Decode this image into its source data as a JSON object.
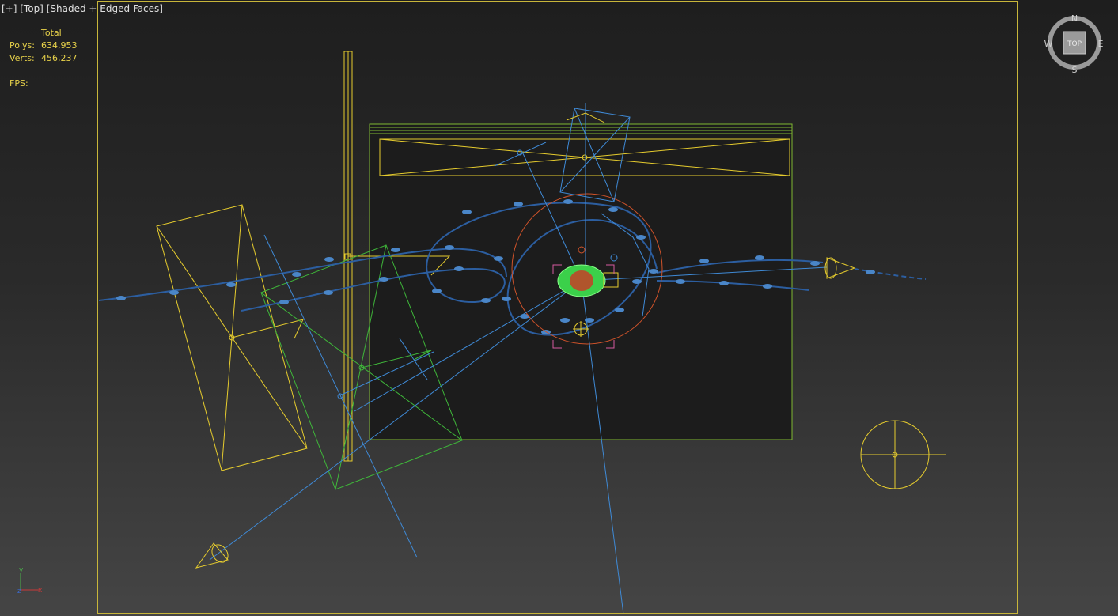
{
  "viewport": {
    "menu_label": "[+]",
    "view_label": "[Top]",
    "shading_label": "[Shaded + Edged Faces]"
  },
  "stats": {
    "header": "Total",
    "polys_label": "Polys:",
    "polys_value": "634,953",
    "verts_label": "Verts:",
    "verts_value": "456,237",
    "fps_label": "FPS:"
  },
  "viewcube": {
    "north": "N",
    "south": "S",
    "east": "E",
    "west": "W",
    "face": "TOP"
  },
  "axis_tripod": {
    "y_label": "y",
    "x_label": "x",
    "z_label": "z"
  },
  "colors": {
    "frame": "#c8b63a",
    "selection_yellow": "#e6cc2e",
    "light_green": "#7fb832",
    "wire_blue": "#3f8ad6",
    "spline_blue": "#2c5ea0",
    "orange": "#d0532a",
    "magenta": "#d65aa0"
  }
}
